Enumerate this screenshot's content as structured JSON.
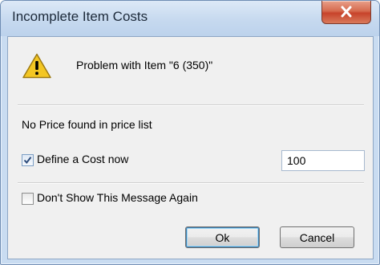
{
  "window": {
    "title": "Incomplete Item Costs"
  },
  "icons": {
    "close": "close-icon",
    "warning": "warning-icon"
  },
  "message": {
    "problem": "Problem with Item \"6 (350)\"",
    "detail": "No Price found in price list"
  },
  "define_cost": {
    "label": "Define a Cost now",
    "checked": true,
    "value": "100"
  },
  "dont_show": {
    "label": "Don't Show This Message Again",
    "checked": false
  },
  "buttons": {
    "ok": "Ok",
    "cancel": "Cancel"
  },
  "colors": {
    "close_button": "#c7432b",
    "title_bar": "#c6d9ef",
    "warning": "#f3c623"
  }
}
